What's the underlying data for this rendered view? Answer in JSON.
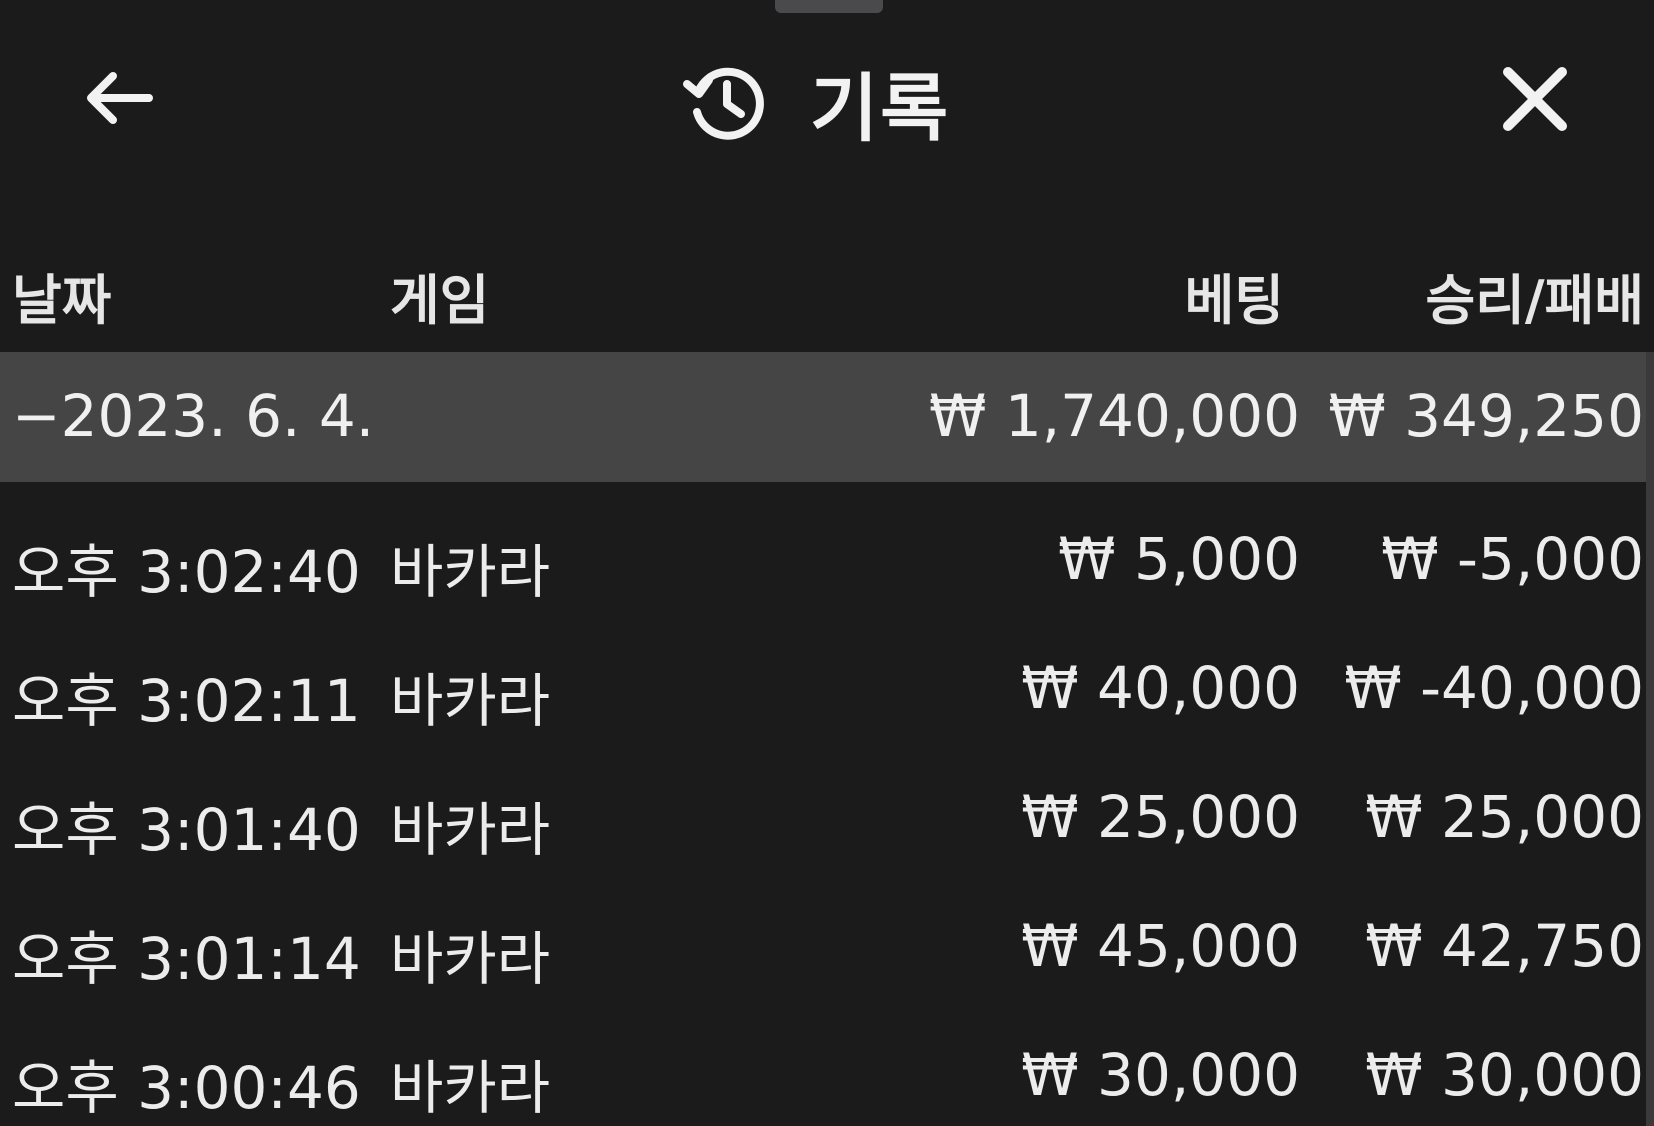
{
  "header": {
    "title": "기록",
    "back_icon": "arrow-left-icon",
    "history_icon": "history-clock-icon",
    "close_icon": "close-x-icon"
  },
  "columns": {
    "date": "날짜",
    "game": "게임",
    "bet": "베팅",
    "result": "승리/패배"
  },
  "summary": {
    "date": "−2023. 6. 4.",
    "bet": "₩ 1,740,000",
    "result": "₩ 349,250"
  },
  "rows": [
    {
      "time": "오후 3:02:40",
      "game": "바카라",
      "bet": "₩ 5,000",
      "result": "₩ -5,000"
    },
    {
      "time": "오후 3:02:11",
      "game": "바카라",
      "bet": "₩ 40,000",
      "result": "₩ -40,000"
    },
    {
      "time": "오후 3:01:40",
      "game": "바카라",
      "bet": "₩ 25,000",
      "result": "₩ 25,000"
    },
    {
      "time": "오후 3:01:14",
      "game": "바카라",
      "bet": "₩ 45,000",
      "result": "₩ 42,750"
    },
    {
      "time": "오후 3:00:46",
      "game": "바카라",
      "bet": "₩ 30,000",
      "result": "₩ 30,000"
    }
  ]
}
